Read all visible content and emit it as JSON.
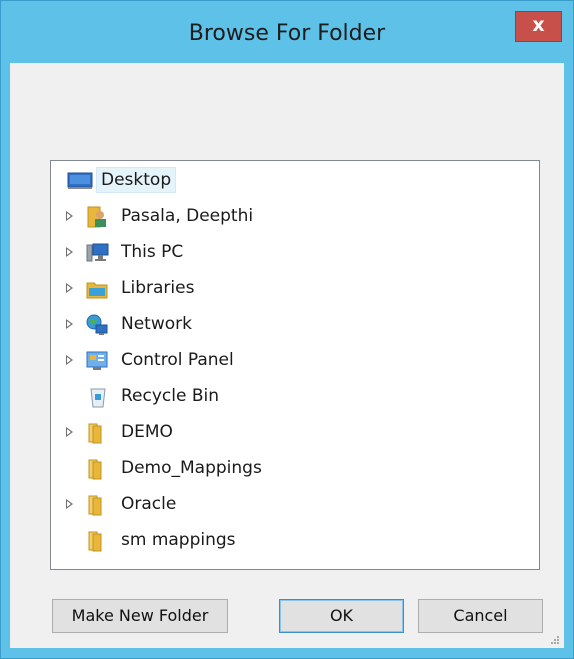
{
  "window": {
    "title": "Browse For Folder",
    "close_label": "x"
  },
  "tree": {
    "items": [
      {
        "label": "Desktop",
        "icon": "desktop-icon",
        "expandable": false,
        "selected": true,
        "level": 0
      },
      {
        "label": "Pasala, Deepthi",
        "icon": "user-folder-icon",
        "expandable": true,
        "level": 1
      },
      {
        "label": "This PC",
        "icon": "computer-icon",
        "expandable": true,
        "level": 1
      },
      {
        "label": "Libraries",
        "icon": "libraries-icon",
        "expandable": true,
        "level": 1
      },
      {
        "label": "Network",
        "icon": "network-icon",
        "expandable": true,
        "level": 1
      },
      {
        "label": "Control Panel",
        "icon": "control-panel-icon",
        "expandable": true,
        "level": 1
      },
      {
        "label": "Recycle Bin",
        "icon": "recycle-bin-icon",
        "expandable": false,
        "level": 1
      },
      {
        "label": "DEMO",
        "icon": "folder-icon",
        "expandable": true,
        "level": 1
      },
      {
        "label": "Demo_Mappings",
        "icon": "folder-icon",
        "expandable": false,
        "level": 1
      },
      {
        "label": "Oracle",
        "icon": "folder-icon",
        "expandable": true,
        "level": 1
      },
      {
        "label": "sm mappings",
        "icon": "folder-icon",
        "expandable": false,
        "level": 1
      }
    ]
  },
  "buttons": {
    "make_new_folder": "Make New Folder",
    "ok": "OK",
    "cancel": "Cancel"
  },
  "colors": {
    "title_bar": "#5ec2e8",
    "close_button": "#c7504a",
    "selection": "#e5f3fb",
    "folder": "#e8b73a"
  }
}
